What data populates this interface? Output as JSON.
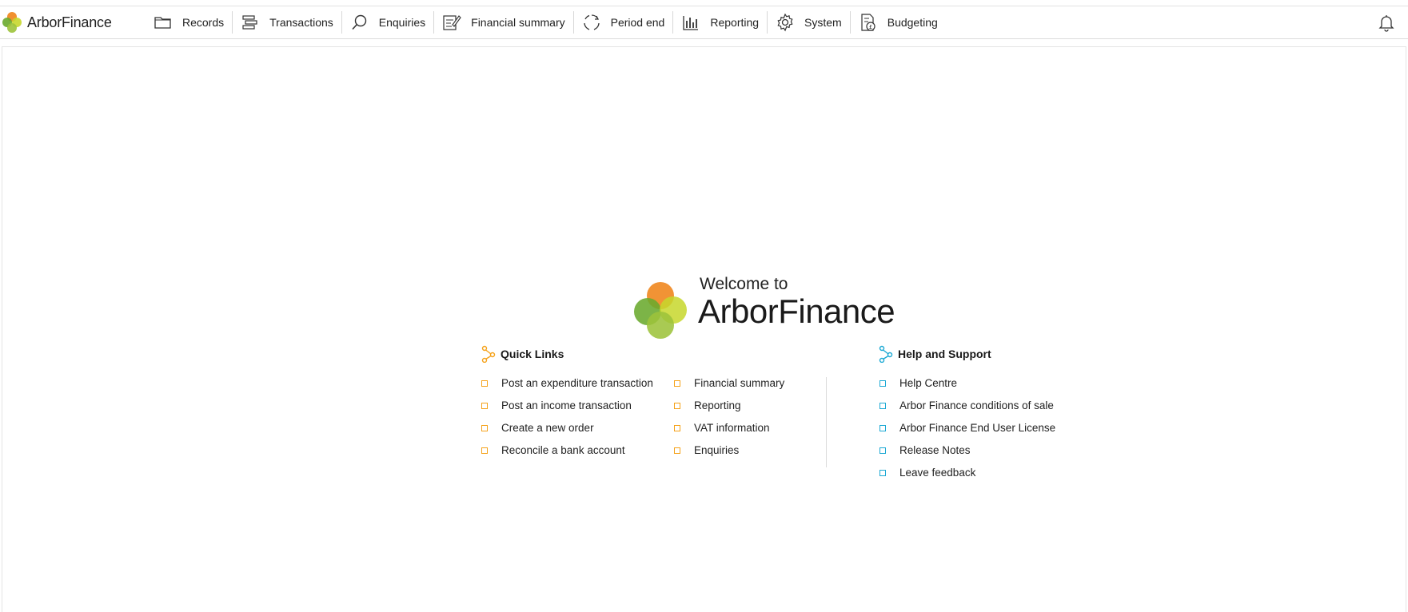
{
  "brand": {
    "name": "ArborFinance"
  },
  "nav": {
    "items": [
      {
        "label": "Records",
        "icon": "folder-icon"
      },
      {
        "label": "Transactions",
        "icon": "transactions-icon"
      },
      {
        "label": "Enquiries",
        "icon": "search-icon"
      },
      {
        "label": "Financial summary",
        "icon": "summary-icon"
      },
      {
        "label": "Period end",
        "icon": "refresh-icon"
      },
      {
        "label": "Reporting",
        "icon": "bar-chart-icon"
      },
      {
        "label": "System",
        "icon": "gear-icon"
      },
      {
        "label": "Budgeting",
        "icon": "budget-document-icon"
      }
    ],
    "notifications_icon": "bell-icon"
  },
  "welcome": {
    "line1": "Welcome to",
    "line2": "ArborFinance"
  },
  "quick_links": {
    "title": "Quick Links",
    "accent": "#f5a21a",
    "column1": [
      "Post an expenditure transaction",
      "Post an income transaction",
      "Create a new order",
      "Reconcile a bank account"
    ],
    "column2": [
      "Financial summary",
      "Reporting",
      "VAT information",
      "Enquiries"
    ]
  },
  "help": {
    "title": "Help and Support",
    "accent": "#1ca9d4",
    "items": [
      "Help Centre",
      "Arbor Finance conditions of sale",
      "Arbor Finance End User License",
      "Release Notes",
      "Leave feedback"
    ]
  },
  "colors": {
    "logo_orange": "#f08a24",
    "logo_green": "#6aaa2e",
    "logo_lime": "#c7d72c",
    "logo_yellowgreen": "#9dc33b"
  }
}
